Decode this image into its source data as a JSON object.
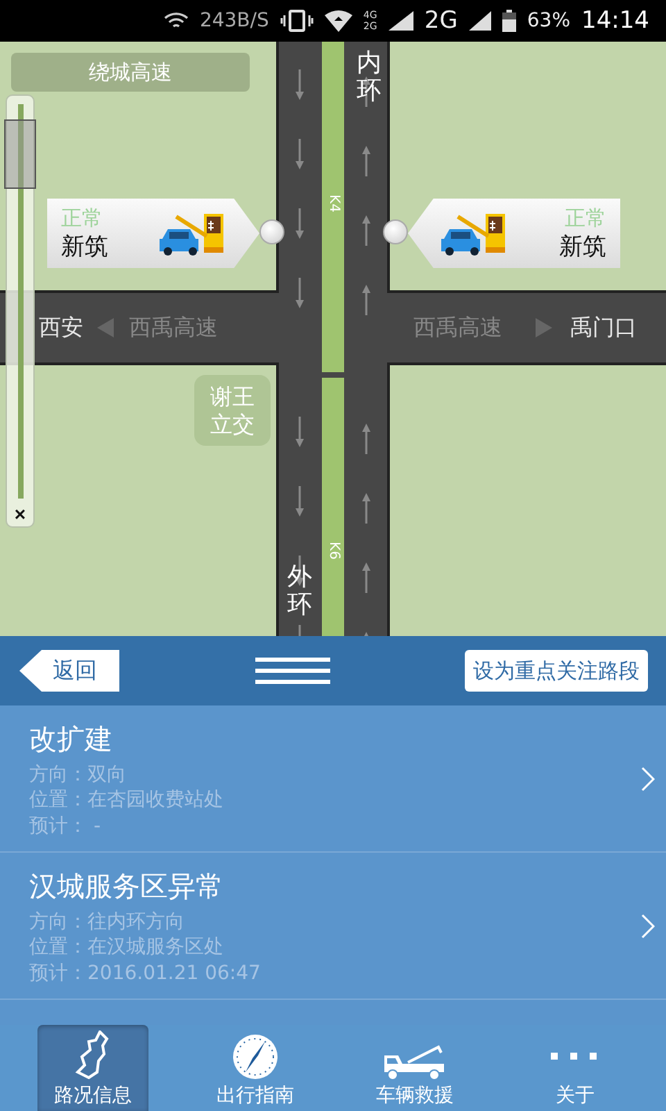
{
  "status_bar": {
    "net_speed": "243B/S",
    "network_small": "4G 2G",
    "network": "2G",
    "battery": "63%",
    "time": "14:14"
  },
  "map": {
    "title": "绕城高速",
    "zoom": {
      "level": 0.93,
      "close": "×"
    },
    "stations": [
      {
        "status": "正常",
        "name": "新筑"
      },
      {
        "status": "正常",
        "name": "新筑"
      }
    ],
    "ring_labels": [
      "内环",
      "外环"
    ],
    "km_markers": [
      "K4",
      "K6"
    ],
    "west": {
      "city": "西安",
      "road": "西禹高速"
    },
    "east": {
      "road": "西禹高速",
      "city": "禹门口"
    },
    "interchange": "谢王立交"
  },
  "toolbar": {
    "back": "返回",
    "focus_button": "设为重点关注路段"
  },
  "incidents": [
    {
      "title": "改扩建",
      "direction": "方向：双向",
      "location": "位置：在杏园收费站处",
      "eta": "预计：  -"
    },
    {
      "title": "汉城服务区异常",
      "direction": "方向：往内环方向",
      "location": "位置：在汉城服务区处",
      "eta": "预计：2016.01.21 06:47"
    }
  ],
  "tabs": [
    {
      "kind": "map",
      "label": "路况信息",
      "selected": true
    },
    {
      "kind": "compass",
      "label": "出行指南",
      "selected": false
    },
    {
      "kind": "truck",
      "label": "车辆救援",
      "selected": false
    },
    {
      "kind": "more",
      "label": "关于",
      "selected": false
    }
  ]
}
